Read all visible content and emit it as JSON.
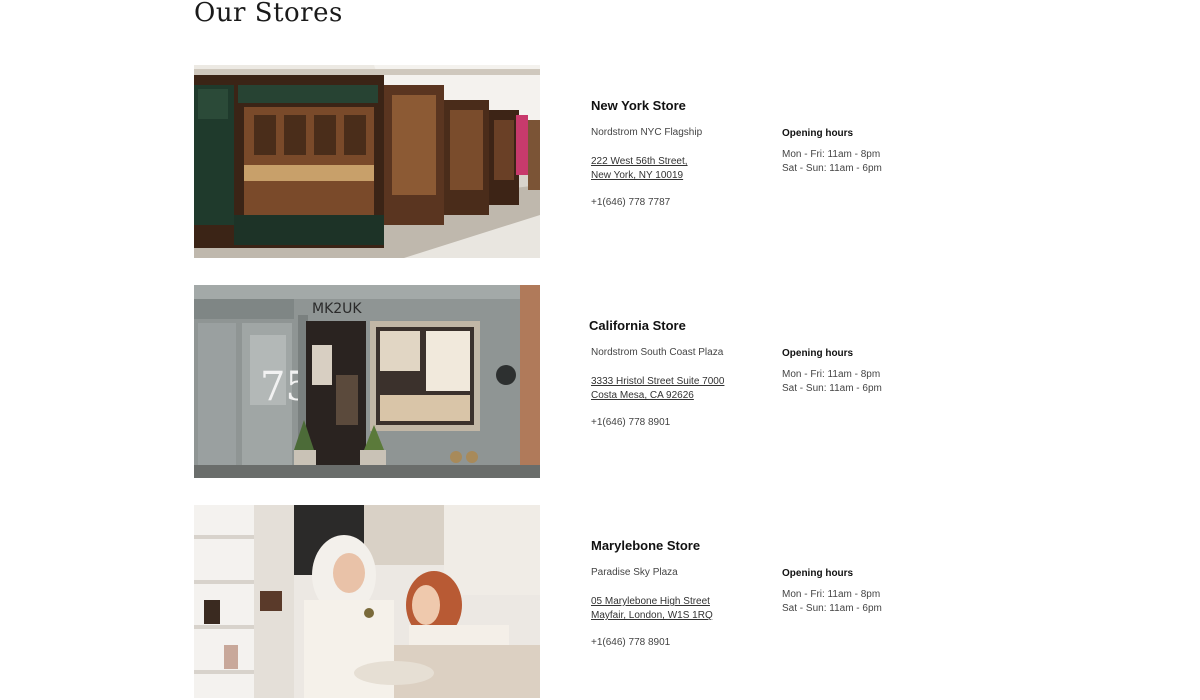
{
  "page": {
    "title": "Our Stores"
  },
  "stores": [
    {
      "name": "New York Store",
      "subtitle": "Nordstrom NYC Flagship",
      "address_line1": "222 West 56th Street,",
      "address_line2": "New York, NY 10019",
      "phone": "+1(646) 778 7787",
      "hours_title": "Opening hours",
      "hours_weekday": "Mon - Fri: 11am - 8pm",
      "hours_weekend": "Sat - Sun: 11am - 6pm",
      "photo": "shopping-arcade-storefronts"
    },
    {
      "name": "California Store",
      "subtitle": "Nordstrom South Coast Plaza",
      "address_line1": "3333 Hristol Street Suite 7000",
      "address_line2": "Costa Mesa, CA 92626",
      "phone": "+1(646) 778 8901",
      "hours_title": "Opening hours",
      "hours_weekday": "Mon - Fri: 11am - 8pm",
      "hours_weekend": "Sat - Sun: 11am - 6pm",
      "photo": "grey-boutique-facade",
      "sign_text": "MK2UK",
      "door_number": "75"
    },
    {
      "name": "Marylebone Store",
      "subtitle": "Paradise Sky Plaza",
      "address_line1": "05 Marylebone High Street",
      "address_line2": "Mayfair, London, W1S 1RQ",
      "phone": "+1(646) 778 8901",
      "hours_title": "Opening hours",
      "hours_weekday": "Mon - Fri: 11am - 8pm",
      "hours_weekend": "Sat - Sun: 11am - 6pm",
      "photo": "boutique-interior-shoppers"
    }
  ]
}
